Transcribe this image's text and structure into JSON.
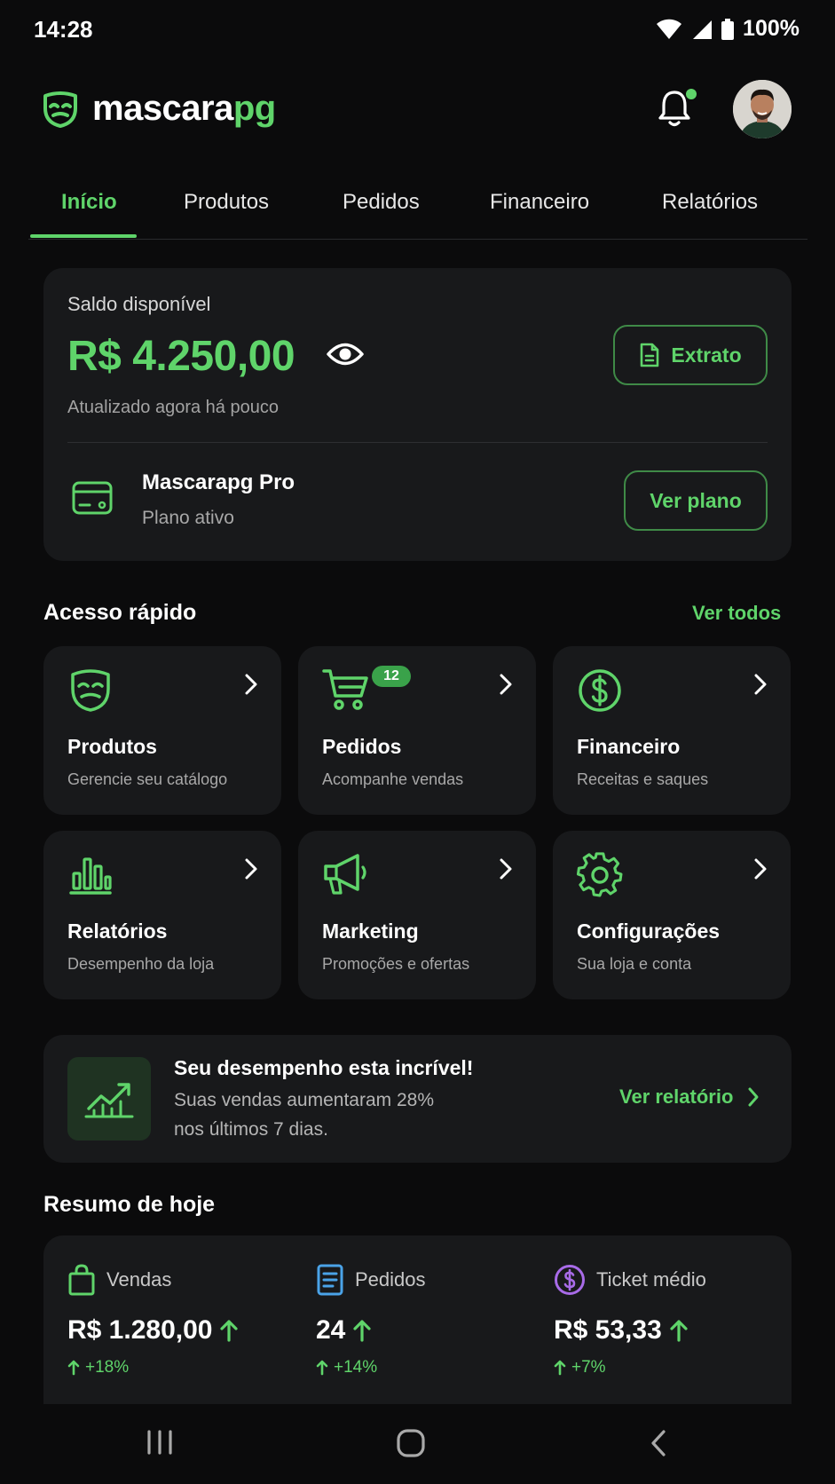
{
  "status_bar": {
    "time": "14:28",
    "battery": "100%"
  },
  "header": {
    "brand_prefix": "mascara",
    "brand_accent": "pg",
    "notification_dot": true
  },
  "tabs": [
    {
      "label": "Início",
      "active": true
    },
    {
      "label": "Produtos",
      "active": false
    },
    {
      "label": "Pedidos",
      "active": false
    },
    {
      "label": "Financeiro",
      "active": false
    },
    {
      "label": "Relatórios",
      "active": false
    }
  ],
  "balance": {
    "label": "Saldo disponível",
    "value": "R$ 4.250,00",
    "updated": "Atualizado agora há pouco",
    "statement_button": "Extrato"
  },
  "plan": {
    "title": "Mascarapg Pro",
    "status": "Plano ativo",
    "button": "Ver plano"
  },
  "quick_access": {
    "title": "Acesso rápido",
    "see_all": "Ver todos",
    "items": [
      {
        "title": "Produtos",
        "subtitle": "Gerencie seu catálogo",
        "icon": "mask-icon"
      },
      {
        "title": "Pedidos",
        "subtitle": "Acompanhe vendas",
        "icon": "cart-icon",
        "badge": "12"
      },
      {
        "title": "Financeiro",
        "subtitle": "Receitas e saques",
        "icon": "dollar-circle-icon"
      },
      {
        "title": "Relatórios",
        "subtitle": "Desempenho da loja",
        "icon": "bar-chart-icon"
      },
      {
        "title": "Marketing",
        "subtitle": "Promoções e ofertas",
        "icon": "megaphone-icon"
      },
      {
        "title": "Configurações",
        "subtitle": "Sua loja e conta",
        "icon": "gear-icon"
      }
    ]
  },
  "performance": {
    "title": "Seu desempenho esta incrível!",
    "line1": "Suas vendas aumentaram 28%",
    "line2": "nos últimos 7 dias.",
    "link": "Ver relatório"
  },
  "summary": {
    "title": "Resumo de hoje",
    "items": [
      {
        "label": "Vendas",
        "value": "R$ 1.280,00",
        "delta": "+18%",
        "icon": "shopping-bag-icon",
        "color": "#5fd46a"
      },
      {
        "label": "Pedidos",
        "value": "24",
        "delta": "+14%",
        "icon": "document-icon",
        "color": "#4aa3e8"
      },
      {
        "label": "Ticket médio",
        "value": "R$ 53,33",
        "delta": "+7%",
        "icon": "dollar-circle-icon",
        "color": "#a86be8"
      }
    ]
  },
  "colors": {
    "accent": "#5fd46a",
    "background": "#0b0b0c",
    "card": "#18191b"
  }
}
